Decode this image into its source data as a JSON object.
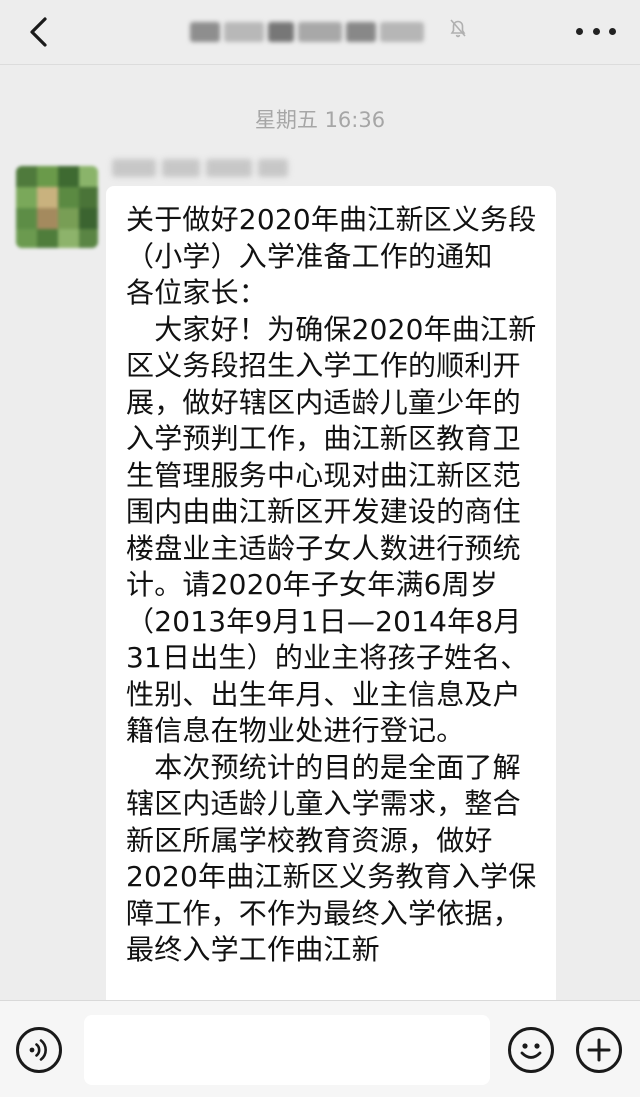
{
  "header": {
    "back_icon": "chevron-left-icon",
    "title_blurred": true,
    "mute_icon": "bell-off-icon",
    "more_icon": "more-dots-icon"
  },
  "timestamp": "星期五 16:36",
  "message": {
    "paragraphs": [
      "关于做好2020年曲江新区义务段（小学）入学准备工作的通知",
      "各位家长：",
      "　大家好！为确保2020年曲江新区义务段招生入学工作的顺利开展，做好辖区内适龄儿童少年的入学预判工作，曲江新区教育卫生管理服务中心现对曲江新区范围内由曲江新区开发建设的商住楼盘业主适龄子女人数进行预统计。请2020年子女年满6周岁（2013年9月1日—2014年8月31日出生）的业主将孩子姓名、性别、出生年月、业主信息及户籍信息在物业处进行登记。",
      "　本次预统计的目的是全面了解辖区内适龄儿童入学需求，整合新区所属学校教育资源，做好2020年曲江新区义务教育入学保障工作，不作为最终入学依据，最终入学工作曲江新"
    ]
  },
  "input_bar": {
    "voice_icon": "voice-icon",
    "emoji_icon": "emoji-icon",
    "plus_icon": "plus-icon",
    "input_value": ""
  },
  "colors": {
    "background": "#ededed",
    "bubble": "#ffffff",
    "bottom_bar": "#f6f6f6",
    "timestamp": "#a6a6a6"
  }
}
